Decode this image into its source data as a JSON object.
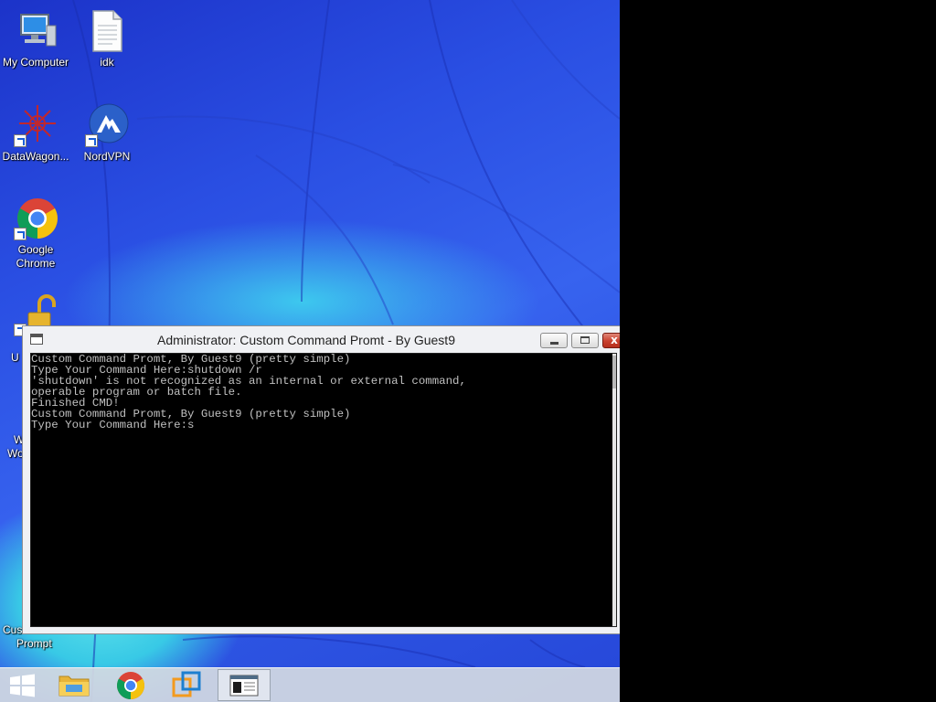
{
  "desktop": {
    "icons": [
      {
        "label": "My Computer",
        "icon": "computer-icon"
      },
      {
        "label": "idk",
        "icon": "text-file-icon"
      },
      {
        "label": "DataWagon...",
        "icon": "datawagon-icon",
        "shortcut": true
      },
      {
        "label": "NordVPN",
        "icon": "nordvpn-icon",
        "shortcut": true
      },
      {
        "label": "Google Chrome",
        "icon": "chrome-icon",
        "shortcut": true
      },
      {
        "label": "U",
        "icon": "unlock-icon",
        "shortcut": true
      },
      {
        "label": "W",
        "icon": "app-icon",
        "shortcut": true
      },
      {
        "label": "Cus",
        "icon": "console-icon"
      },
      {
        "label": "Prompt",
        "icon": "console-icon"
      }
    ]
  },
  "window": {
    "title": "Administrator:  Custom Command Promt - By Guest9",
    "buttons": {
      "minimize": "minimize-icon",
      "maximize": "maximize-icon",
      "close": "x"
    },
    "console_text": "Custom Command Promt, By Guest9 (pretty simple)\nType Your Command Here:shutdown /r\n'shutdown' is not recognized as an internal or external command,\noperable program or batch file.\nFinished CMD!\nCustom Command Promt, By Guest9 (pretty simple)\nType Your Command Here:s"
  },
  "taskbar": {
    "items": [
      {
        "name": "start-button",
        "icon": "windows-logo-icon"
      },
      {
        "name": "file-explorer",
        "icon": "folder-icon"
      },
      {
        "name": "google-chrome",
        "icon": "chrome-icon"
      },
      {
        "name": "vmware",
        "icon": "vmware-icon"
      },
      {
        "name": "custom-command-promt",
        "icon": "console-window-icon",
        "active": true
      }
    ]
  },
  "colors": {
    "console_bg": "#000000",
    "console_fg": "#c0c0c0",
    "close_button": "#c9402e",
    "desktop_blue": "#2a4fe3",
    "desktop_cyan": "#38c9e6"
  }
}
